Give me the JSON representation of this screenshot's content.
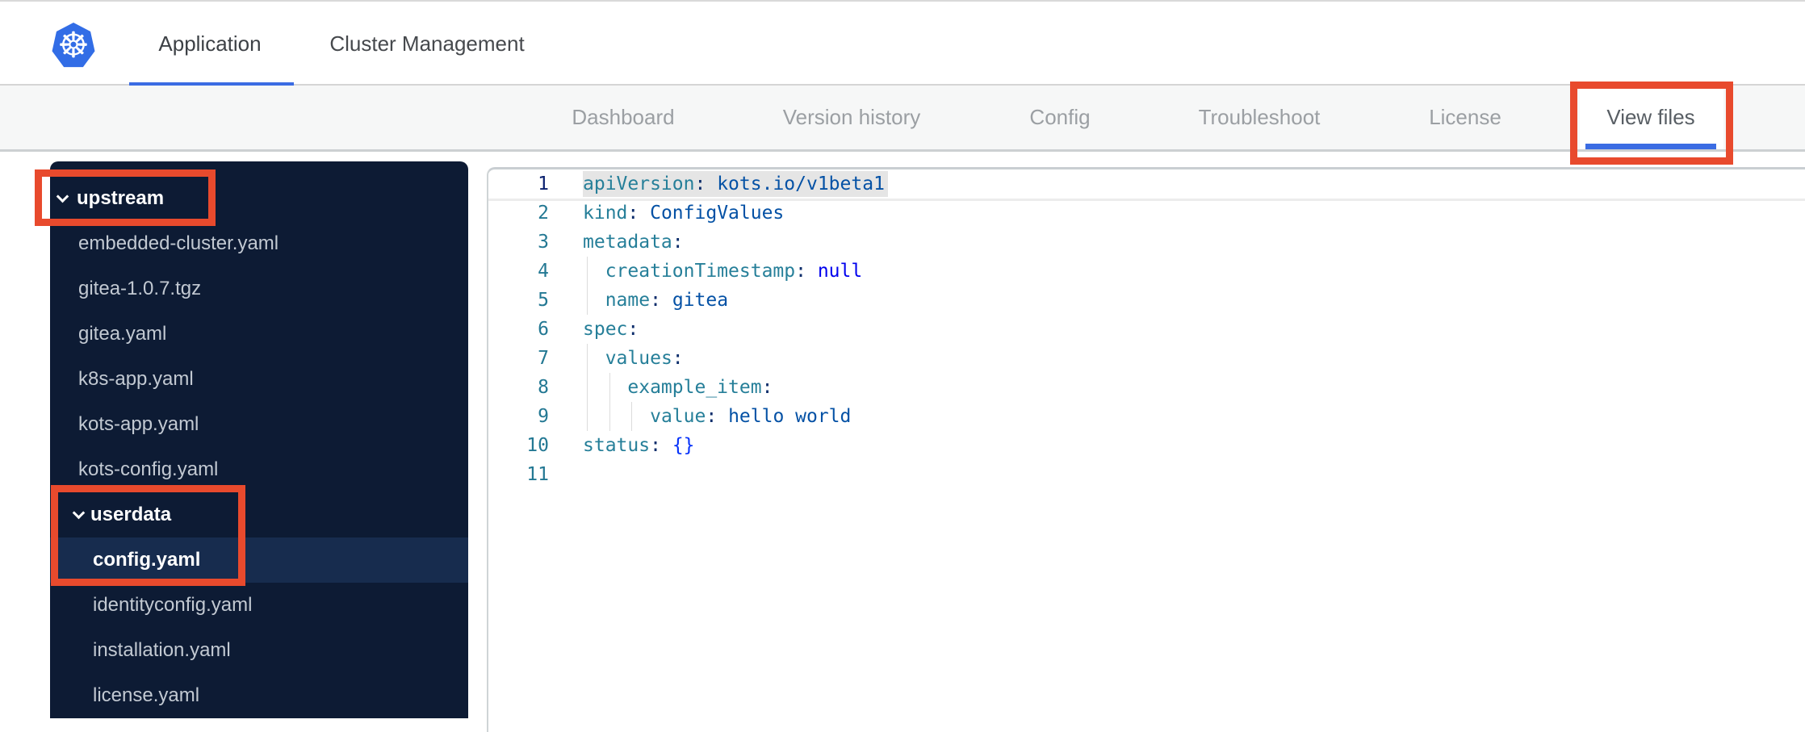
{
  "colors": {
    "accent": "#3b6ce3",
    "annotation": "#e84a2d",
    "kubernetes_blue": "#326de6",
    "sidebar_bg": "#0d1b34",
    "sidebar_selected_bg": "#172c4e"
  },
  "header": {
    "tabs": [
      {
        "label": "Application",
        "active": true
      },
      {
        "label": "Cluster Management",
        "active": false
      }
    ]
  },
  "subnav": {
    "items": [
      {
        "label": "Dashboard",
        "active": false
      },
      {
        "label": "Version history",
        "active": false
      },
      {
        "label": "Config",
        "active": false
      },
      {
        "label": "Troubleshoot",
        "active": false
      },
      {
        "label": "License",
        "active": false
      },
      {
        "label": "View files",
        "active": true
      }
    ]
  },
  "sidebar": {
    "rows": [
      {
        "label": "upstream",
        "type": "folder",
        "depth": 0,
        "expanded": true,
        "selected": false
      },
      {
        "label": "embedded-cluster.yaml",
        "type": "file",
        "depth": 1,
        "selected": false
      },
      {
        "label": "gitea-1.0.7.tgz",
        "type": "file",
        "depth": 1,
        "selected": false
      },
      {
        "label": "gitea.yaml",
        "type": "file",
        "depth": 1,
        "selected": false
      },
      {
        "label": "k8s-app.yaml",
        "type": "file",
        "depth": 1,
        "selected": false
      },
      {
        "label": "kots-app.yaml",
        "type": "file",
        "depth": 1,
        "selected": false
      },
      {
        "label": "kots-config.yaml",
        "type": "file",
        "depth": 1,
        "selected": false
      },
      {
        "label": "userdata",
        "type": "folder",
        "depth": 1,
        "expanded": true,
        "selected": false
      },
      {
        "label": "config.yaml",
        "type": "file",
        "depth": 2,
        "selected": true
      },
      {
        "label": "identityconfig.yaml",
        "type": "file",
        "depth": 2,
        "selected": false
      },
      {
        "label": "installation.yaml",
        "type": "file",
        "depth": 2,
        "selected": false
      },
      {
        "label": "license.yaml",
        "type": "file",
        "depth": 2,
        "selected": false
      }
    ]
  },
  "editor": {
    "active_line": 1,
    "lines": [
      {
        "no": 1,
        "guides": 0,
        "selected": true,
        "segs": [
          [
            "apiVersion",
            "key"
          ],
          [
            ":",
            "pun"
          ],
          [
            " ",
            ""
          ],
          [
            "kots.io/v1beta1",
            "val"
          ]
        ]
      },
      {
        "no": 2,
        "guides": 0,
        "selected": false,
        "segs": [
          [
            "kind",
            "key"
          ],
          [
            ":",
            "pun"
          ],
          [
            " ",
            ""
          ],
          [
            "ConfigValues",
            "val"
          ]
        ]
      },
      {
        "no": 3,
        "guides": 0,
        "selected": false,
        "segs": [
          [
            "metadata",
            "key"
          ],
          [
            ":",
            "pun"
          ]
        ]
      },
      {
        "no": 4,
        "guides": 1,
        "selected": false,
        "segs": [
          [
            "  ",
            ""
          ],
          [
            "creationTimestamp",
            "key"
          ],
          [
            ":",
            "pun"
          ],
          [
            " ",
            ""
          ],
          [
            "null",
            "kw"
          ]
        ]
      },
      {
        "no": 5,
        "guides": 1,
        "selected": false,
        "segs": [
          [
            "  ",
            ""
          ],
          [
            "name",
            "key"
          ],
          [
            ":",
            "pun"
          ],
          [
            " ",
            ""
          ],
          [
            "gitea",
            "val"
          ]
        ]
      },
      {
        "no": 6,
        "guides": 0,
        "selected": false,
        "segs": [
          [
            "spec",
            "key"
          ],
          [
            ":",
            "pun"
          ]
        ]
      },
      {
        "no": 7,
        "guides": 1,
        "selected": false,
        "segs": [
          [
            "  ",
            ""
          ],
          [
            "values",
            "key"
          ],
          [
            ":",
            "pun"
          ]
        ]
      },
      {
        "no": 8,
        "guides": 2,
        "selected": false,
        "segs": [
          [
            "    ",
            ""
          ],
          [
            "example_item",
            "key"
          ],
          [
            ":",
            "pun"
          ]
        ]
      },
      {
        "no": 9,
        "guides": 3,
        "selected": false,
        "segs": [
          [
            "      ",
            ""
          ],
          [
            "value",
            "key"
          ],
          [
            ":",
            "pun"
          ],
          [
            " ",
            ""
          ],
          [
            "hello world",
            "val"
          ]
        ]
      },
      {
        "no": 10,
        "guides": 0,
        "selected": false,
        "segs": [
          [
            "status",
            "key"
          ],
          [
            ":",
            "pun"
          ],
          [
            " ",
            ""
          ],
          [
            "{}",
            "br"
          ]
        ]
      },
      {
        "no": 11,
        "guides": 0,
        "selected": false,
        "segs": []
      }
    ]
  }
}
